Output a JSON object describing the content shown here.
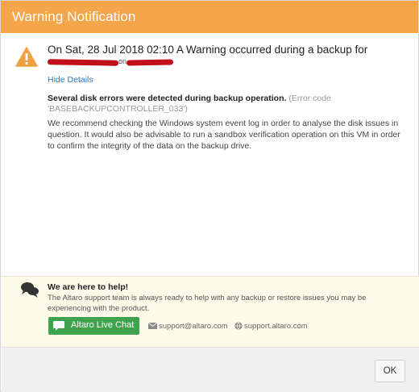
{
  "window": {
    "title": "Warning Notification"
  },
  "message": {
    "headline": "On Sat, 28 Jul 2018 02:10 A Warning occurred during a backup for",
    "redacted_connector": "on",
    "hide_details_link": "Hide Details",
    "error_title": "Several disk errors were detected during backup operation.",
    "error_code": "(Error code 'BASEBACKUPCONTROLLER_033')",
    "recommendation": "We recommend checking the Windows system event log in order to analyse the disk issues in question. It would also be advisable to run a sandbox verification operation on this VM in order to confirm the integrity of the data on the backup drive."
  },
  "support": {
    "title": "We are here to help!",
    "text": "The Altaro support team is always ready to help with any backup or restore issues you may be experiencing with the product.",
    "live_chat_label": "Altaro Live Chat",
    "email": "support@altaro.com",
    "website": "support.altaro.com"
  },
  "footer": {
    "ok_label": "OK"
  },
  "colors": {
    "titlebar": "#f5a54a",
    "warning_icon": "#f0a040",
    "link": "#2a79c9",
    "live_chat": "#3fa34d",
    "support_bg": "#fdfbe9",
    "redaction": "#c0101a"
  },
  "icons": {
    "warning": "warning-triangle-icon",
    "chat": "chat-bubbles-icon",
    "live_chat": "chat-icon",
    "email": "envelope-icon",
    "website": "globe-icon"
  }
}
